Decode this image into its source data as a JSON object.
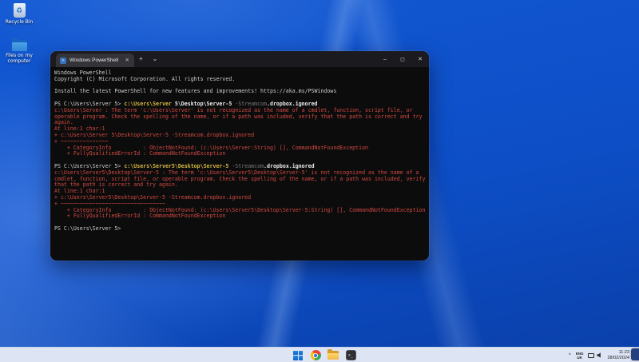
{
  "desktop": {
    "icons": [
      {
        "label": "Recycle Bin"
      },
      {
        "label": "Files on my computer"
      }
    ]
  },
  "window": {
    "tab_title": "Windows PowerShell",
    "tab_close": "✕",
    "new_tab": "+",
    "dropdown": "⌄",
    "minimize": "–",
    "maximize": "◻",
    "close": "✕",
    "ps_icon_glyph": ">"
  },
  "terminal": {
    "colors": {
      "default": "#cccccc",
      "command_yellow": "#d8b840",
      "parameter_gray": "#7a7a7a",
      "bold_white": "#ededed",
      "error_red": "#d24a43",
      "background": "#0c0c0c"
    },
    "lines": [
      [
        {
          "t": "Windows PowerShell",
          "c": "d"
        }
      ],
      [
        {
          "t": "Copyright (C) Microsoft Corporation. All rights reserved.",
          "c": "d"
        }
      ],
      [],
      [
        {
          "t": "Install the latest PowerShell for new features and improvements! https://aka.ms/PSWindows",
          "c": "d"
        }
      ],
      [],
      [
        {
          "t": "PS C:\\Users\\Server 5> ",
          "c": "d"
        },
        {
          "t": "c:\\Users\\Server",
          "c": "y"
        },
        {
          "t": " 5\\Desktop\\Server-5 ",
          "c": "w"
        },
        {
          "t": "-Streamcom",
          "c": "g"
        },
        {
          "t": ".dropbox.ignored",
          "c": "w"
        }
      ],
      [
        {
          "t": "c:\\Users\\Server : The term 'c:\\Users\\Server' is not recognized as the name of a cmdlet, function, script file, or",
          "c": "e"
        }
      ],
      [
        {
          "t": "operable program. Check the spelling of the name, or if a path was included, verify that the path is correct and try",
          "c": "e"
        }
      ],
      [
        {
          "t": "again.",
          "c": "e"
        }
      ],
      [
        {
          "t": "At line:1 char:1",
          "c": "e"
        }
      ],
      [
        {
          "t": "+ c:\\Users\\Server 5\\Desktop\\Server-5 -Streamcom.dropbox.ignored",
          "c": "e"
        }
      ],
      [
        {
          "t": "+ ~~~~~~~~~~~~~~~",
          "c": "e"
        }
      ],
      [
        {
          "t": "    + CategoryInfo          : ObjectNotFound: (c:\\Users\\Server:String) [], CommandNotFoundException",
          "c": "e"
        }
      ],
      [
        {
          "t": "    + FullyQualifiedErrorId : CommandNotFoundException",
          "c": "e"
        }
      ],
      [],
      [
        {
          "t": "PS C:\\Users\\Server 5> ",
          "c": "d"
        },
        {
          "t": "c:\\Users\\Server5\\Desktop\\Server-5",
          "c": "y"
        },
        {
          "t": " ",
          "c": "d"
        },
        {
          "t": "-Streamcom",
          "c": "g"
        },
        {
          "t": ".dropbox.ignored",
          "c": "w"
        }
      ],
      [
        {
          "t": "c:\\Users\\Server5\\Desktop\\Server-5 : The term 'c:\\Users\\Server5\\Desktop\\Server-5' is not recognized as the name of a",
          "c": "e"
        }
      ],
      [
        {
          "t": "cmdlet, function, script file, or operable program. Check the spelling of the name, or if a path was included, verify",
          "c": "e"
        }
      ],
      [
        {
          "t": "that the path is correct and try again.",
          "c": "e"
        }
      ],
      [
        {
          "t": "At line:1 char:1",
          "c": "e"
        }
      ],
      [
        {
          "t": "+ c:\\Users\\Server5\\Desktop\\Server-5 -Streamcom.dropbox.ignored",
          "c": "e"
        }
      ],
      [
        {
          "t": "+ ~~~~~~~~~~~~~~~~~~~~~~~~~~~~~~~~~",
          "c": "e"
        }
      ],
      [
        {
          "t": "    + CategoryInfo          : ObjectNotFound: (c:\\Users\\Server5\\Desktop\\Server-5:String) [], CommandNotFoundException",
          "c": "e"
        }
      ],
      [
        {
          "t": "    + FullyQualifiedErrorId : CommandNotFoundException",
          "c": "e"
        }
      ],
      [],
      [
        {
          "t": "PS C:\\Users\\Server 5>",
          "c": "d"
        }
      ]
    ]
  },
  "taskbar": {
    "items": [
      {
        "label": "Start"
      },
      {
        "label": "Google Chrome"
      },
      {
        "label": "File Explorer"
      },
      {
        "label": "Windows Terminal"
      }
    ],
    "tray": {
      "chevron": "^",
      "language_line1": "ENG",
      "language_line2": "UK",
      "time": "11:23",
      "date": "28/02/2024"
    }
  }
}
